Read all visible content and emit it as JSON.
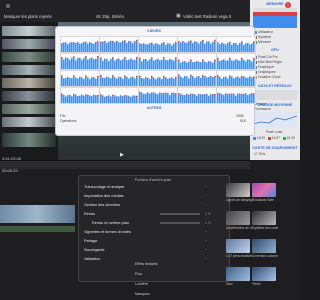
{
  "toolbar": {
    "filter_label": "Masquer les plans rejetés",
    "format_label": "4K 25p, Stéréo",
    "project_label": "Vidéo test Radeon vega II"
  },
  "timecode": "00:00:29",
  "duration": "3:01:23:26",
  "inspector": {
    "section_top": "MÉMOIRE",
    "legend_top": [
      "Utilisateur",
      "Système",
      "Mémoire"
    ],
    "section_cpu": "GPU",
    "cpu_items": [
      "Final Cut Pro",
      "Mac Mini Plugin",
      "Graphique",
      "Graphiques",
      "Creative Cloud"
    ],
    "section_mid": "DATA ET RÉSEAUX",
    "mid_items": [
      "Mémoire",
      "Processeur"
    ],
    "section_bottom": "CHARGE MOYENNE",
    "peak_label": "Peak Load",
    "peak_values": [
      "15.39",
      "16.57",
      "18.35"
    ],
    "section_trend": "CARTE DE CHARGEMENT",
    "trend_value": "17 GHz",
    "badge": "1"
  },
  "monitor": {
    "title": "CŒURS",
    "threads_label": "HYPER-THREADING",
    "footer_title": "AUTRES",
    "stat_rows": [
      {
        "label": "File",
        "value": "2838"
      },
      {
        "label": "Opérations",
        "value": "518"
      }
    ],
    "cells": [
      62,
      70,
      55,
      68,
      58,
      72,
      66,
      64,
      50,
      61,
      57,
      59,
      55,
      63,
      60,
      52,
      48,
      66,
      58,
      61
    ]
  },
  "menu": {
    "title": "Fichiers d'arrière-plan",
    "items": [
      {
        "label": "Transcodage et analyse",
        "key": "~"
      },
      {
        "label": "Importation des médias",
        "key": "~"
      },
      {
        "label": "Gestion des données",
        "key": "~"
      },
      {
        "label": "Rendu",
        "key": "1 %"
      },
      {
        "label": "Rendu en arrière-plan",
        "key": "1 %"
      },
      {
        "label": "Vignettes et formes d'ondes",
        "key": "~"
      },
      {
        "label": "Partage",
        "key": "~"
      },
      {
        "label": "Sauvegarde",
        "key": "~"
      },
      {
        "label": "Validation",
        "key": "~"
      }
    ]
  },
  "library": {
    "items": [
      "Effets textuels",
      "Flou",
      "Lumière",
      "Masques"
    ]
  },
  "effects": {
    "items": [
      "Lignes de balayage",
      "Broadcast Safe",
      "Amplificateur de couleurs",
      "Équilibre des couleurs",
      "LUT personnalisée",
      "Correction colorimétrique",
      "Halo",
      "Teinte"
    ]
  },
  "colors": {
    "accent": "#2d6fd6",
    "bar_blue": "#3f8ef0",
    "bar_red": "#d94040",
    "bar_green": "#3aa64a",
    "bar_purple": "#8a4ec9"
  }
}
